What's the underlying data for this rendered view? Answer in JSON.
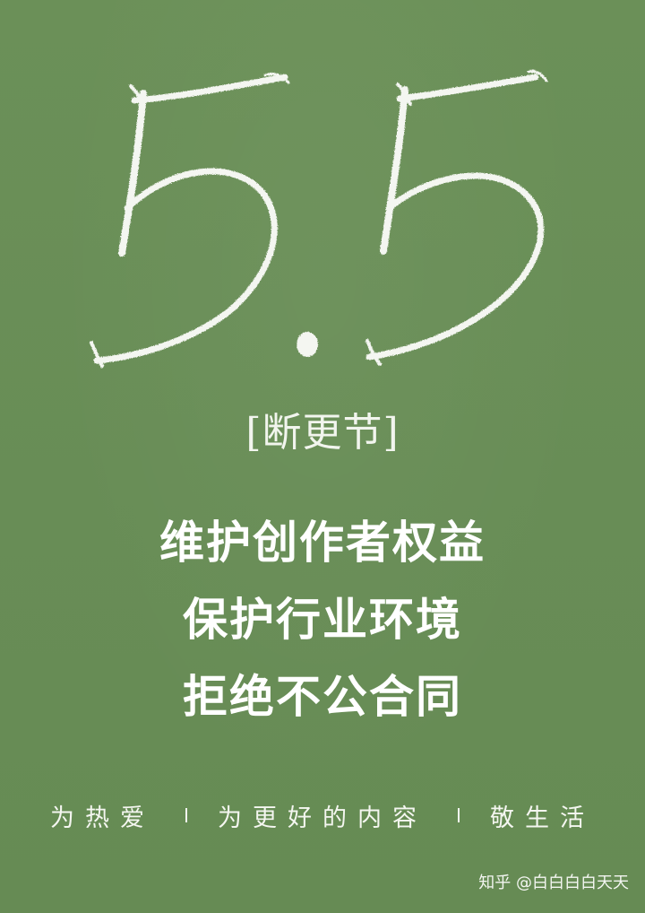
{
  "hero": {
    "numeral": "5.5",
    "style": "white-chalk-brush"
  },
  "subtitle": "[断更节]",
  "slogans": [
    "维护创作者权益",
    "保护行业环境",
    "拒绝不公合同"
  ],
  "footer": {
    "segments": [
      "为热爱",
      "为更好的内容",
      "敬生活"
    ]
  },
  "watermark": "知乎 @白白白白天天",
  "colors": {
    "background": "#6a8f57",
    "text": "#ffffff"
  }
}
